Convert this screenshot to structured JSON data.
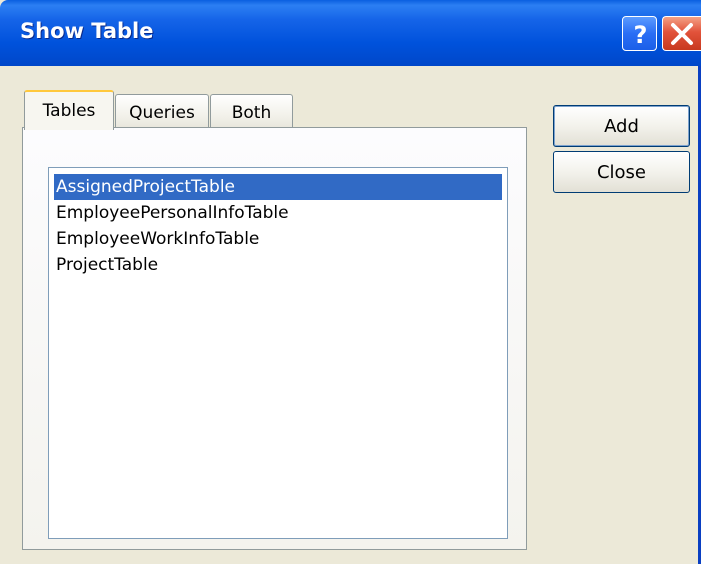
{
  "window": {
    "title": "Show Table",
    "help_icon": "help-icon",
    "close_icon": "close-icon"
  },
  "tabs": [
    {
      "label": "Tables",
      "active": true
    },
    {
      "label": "Queries",
      "active": false
    },
    {
      "label": "Both",
      "active": false
    }
  ],
  "list": {
    "items": [
      {
        "label": "AssignedProjectTable",
        "selected": true
      },
      {
        "label": "EmployeePersonalInfoTable",
        "selected": false
      },
      {
        "label": "EmployeeWorkInfoTable",
        "selected": false
      },
      {
        "label": "ProjectTable",
        "selected": false
      }
    ]
  },
  "buttons": {
    "add_label": "Add",
    "close_label": "Close"
  },
  "colors": {
    "titlebar": "#0052dc",
    "selection": "#316ac5",
    "dialog_bg": "#ece9d8"
  }
}
